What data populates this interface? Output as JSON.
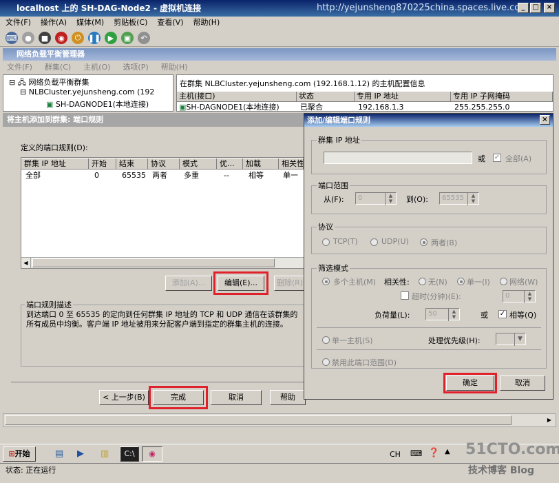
{
  "window": {
    "title": "localhost 上的 SH-DAG-Node2 - 虚拟机连接",
    "watermark": "http://yejunsheng870225china.spaces.live.com"
  },
  "vm_menu": [
    "文件(F)",
    "操作(A)",
    "媒体(M)",
    "剪贴板(C)",
    "查看(V)",
    "帮助(H)"
  ],
  "nlb": {
    "title": "网络负载平衡管理器",
    "menu": [
      "文件(F)",
      "群集(C)",
      "主机(O)",
      "选项(P)",
      "帮助(H)"
    ],
    "tree": {
      "root": "网络负载平衡群集",
      "cluster": "NLBCluster.yejunsheng.com (192",
      "host": "SH-DAGNODE1(本地连接)"
    },
    "info": "在群集 NLBCluster.yejunsheng.com (192.168.1.12) 的主机配置信息",
    "columns": [
      "主机(接口)",
      "状态",
      "专用 IP 地址",
      "专用 IP 子网掩码"
    ],
    "row": [
      "SH-DAGNODE1(本地连接)",
      "已聚合",
      "192.168.1.3",
      "255.255.255.0"
    ]
  },
  "wizard": {
    "title": "将主机添加到群集: 端口规则",
    "defined_label": "定义的端口规则(D):",
    "columns": [
      "群集 IP 地址",
      "开始",
      "结束",
      "协议",
      "模式",
      "优...",
      "加载",
      "相关性"
    ],
    "row": [
      "全部",
      "0",
      "65535",
      "两者",
      "多重",
      "--",
      "相等",
      "单一"
    ],
    "add_label": "添加(A)...",
    "edit_label": "编辑(E)...",
    "remove_label": "删除(R)",
    "desc_title": "端口规则描述",
    "desc_text": "到达端口 0 至 65535 的定向到任何群集 IP 地址的 TCP 和 UDP 通信在该群集的所有成员中均衡。客户端 IP 地址被用来分配客户端到指定的群集主机的连接。",
    "back_label": "< 上一步(B)",
    "finish_label": "完成",
    "cancel_label": "取消",
    "help_label": "帮助"
  },
  "dialog": {
    "title": "添加/编辑端口规则",
    "cluster_ip_group": "群集 IP 地址",
    "or_label": "或",
    "all_label": "全部(A)",
    "port_range_group": "端口范围",
    "from_label": "从(F):",
    "from_value": "0",
    "to_label": "到(O):",
    "to_value": "65535",
    "protocol_group": "协议",
    "tcp_label": "TCP(T)",
    "udp_label": "UDP(U)",
    "both_label": "两者(B)",
    "filter_group": "筛选模式",
    "multi_host_label": "多个主机(M)",
    "affinity_label": "相关性:",
    "none_label": "无(N)",
    "single_label": "单一(I)",
    "network_label": "网络(W)",
    "timeout_label": "超时(分钟)(E):",
    "timeout_value": "0",
    "load_label": "负荷量(L):",
    "load_value": "50",
    "or2_label": "或",
    "equal_label": "相等(Q)",
    "single_host_label": "单一主机(S)",
    "priority_label": "处理优先级(H):",
    "disable_label": "禁用此端口范围(D)",
    "ok_label": "确定",
    "cancel_label": "取消"
  },
  "taskbar": {
    "start": "开始",
    "lang": "CH"
  },
  "status": {
    "text": "状态: 正在运行"
  },
  "branding": {
    "logo": "51CTO.com",
    "sub": "技术博客 Blog"
  }
}
